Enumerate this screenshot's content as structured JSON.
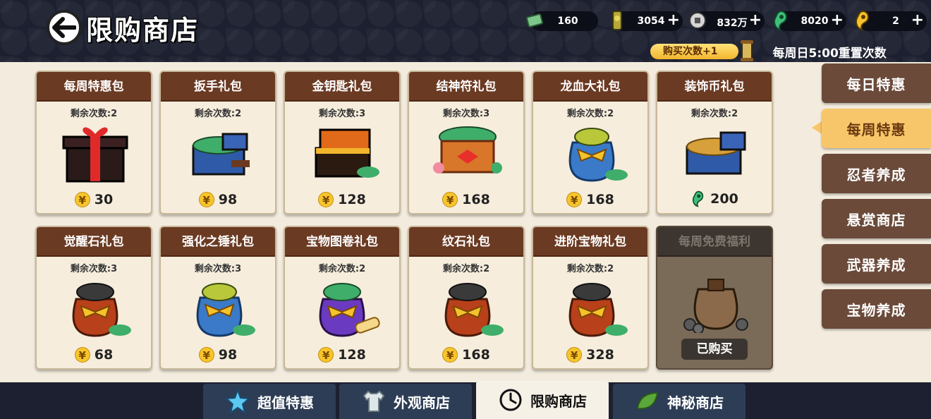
{
  "header": {
    "title": "限购商店",
    "currencies": [
      {
        "icon": "jade-ticket-icon",
        "value": "160",
        "has_plus": false
      },
      {
        "icon": "ninja-token-icon",
        "value": "3054",
        "has_plus": true
      },
      {
        "icon": "silver-coin-icon",
        "value": "832万",
        "has_plus": true
      },
      {
        "icon": "green-magatama-icon",
        "value": "8020",
        "has_plus": true
      },
      {
        "icon": "gold-magatama-icon",
        "value": "2",
        "has_plus": true
      }
    ],
    "buy_count_label": "购买次数+1",
    "reset_note": "每周日5:00重置次数"
  },
  "cards": [
    {
      "name": "每周特惠包",
      "remain": "剩余次数:2",
      "price": "30",
      "currency": "yuan",
      "art": "red-gift-box"
    },
    {
      "name": "扳手礼包",
      "remain": "剩余次数:2",
      "price": "98",
      "currency": "yuan",
      "art": "blue-chest"
    },
    {
      "name": "金钥匙礼包",
      "remain": "剩余次数:3",
      "price": "128",
      "currency": "yuan",
      "art": "gold-chest"
    },
    {
      "name": "结神符礼包",
      "remain": "剩余次数:3",
      "price": "168",
      "currency": "yuan",
      "art": "ribbon-basket"
    },
    {
      "name": "龙血大礼包",
      "remain": "剩余次数:2",
      "price": "168",
      "currency": "yuan",
      "art": "blue-bag"
    },
    {
      "name": "装饰币礼包",
      "remain": "剩余次数:2",
      "price": "200",
      "currency": "magatama",
      "art": "coin-chest"
    },
    {
      "name": "觉醒石礼包",
      "remain": "剩余次数:3",
      "price": "68",
      "currency": "yuan",
      "art": "red-bag"
    },
    {
      "name": "强化之锤礼包",
      "remain": "剩余次数:3",
      "price": "98",
      "currency": "yuan",
      "art": "blue-bag"
    },
    {
      "name": "宝物图卷礼包",
      "remain": "剩余次数:2",
      "price": "128",
      "currency": "yuan",
      "art": "purple-bag"
    },
    {
      "name": "纹石礼包",
      "remain": "剩余次数:2",
      "price": "168",
      "currency": "yuan",
      "art": "red-bag"
    },
    {
      "name": "进阶宝物礼包",
      "remain": "剩余次数:2",
      "price": "328",
      "currency": "yuan",
      "art": "red-bag"
    },
    {
      "name": "每周免费福利",
      "bought_label": "已购买",
      "art": "coin-sack"
    }
  ],
  "currency_symbol": "¥",
  "side_tabs": [
    "每日特惠",
    "每周特惠",
    "忍者养成",
    "悬赏商店",
    "武器养成",
    "宝物养成"
  ],
  "side_active": "每周特惠",
  "bottom_tabs": [
    {
      "label": "超值特惠",
      "icon": "star-icon"
    },
    {
      "label": "外观商店",
      "icon": "shirt-icon"
    },
    {
      "label": "限购商店",
      "icon": "clock-icon"
    },
    {
      "label": "神秘商店",
      "icon": "leaf-icon"
    }
  ],
  "bottom_active": "限购商店",
  "colors": {
    "header_bg": "#1c2030",
    "card_header": "#6b3a23",
    "tab_active": "#f8c66a",
    "tab_inactive": "#6b4a3a"
  }
}
